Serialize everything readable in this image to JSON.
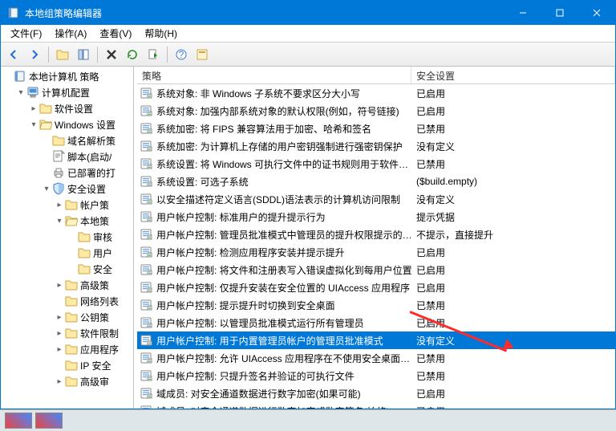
{
  "title": "本地组策略编辑器",
  "menu": [
    "文件(F)",
    "操作(A)",
    "查看(V)",
    "帮助(H)"
  ],
  "columns": {
    "policy": "策略",
    "setting": "安全设置"
  },
  "tree": {
    "root": {
      "label": "本地计算机 策略",
      "expandable": false
    },
    "computer_config": "计算机配置",
    "software_settings": "软件设置",
    "windows_settings": "Windows 设置",
    "dns": "域名解析策",
    "scripts": "脚本(启动/",
    "deployed": "已部署的打",
    "security": "安全设置",
    "account": "帐户策",
    "local": "本地策",
    "audit": "审核",
    "user_rights": "用户",
    "sec_options": "安全",
    "advanced": "高级策",
    "network": "网络列表",
    "public_key": "公钥策",
    "restrict": "软件限制",
    "app_ctrl": "应用程序",
    "ip_sec": "IP 安全",
    "adv_audit": "高级审"
  },
  "rows": [
    {
      "policy": "系统对象: 非 Windows 子系统不要求区分大小写",
      "setting": "已启用"
    },
    {
      "policy": "系统对象: 加强内部系统对象的默认权限(例如，符号链接)",
      "setting": "已启用"
    },
    {
      "policy": "系统加密: 将 FIPS 兼容算法用于加密、哈希和签名",
      "setting": "已禁用"
    },
    {
      "policy": "系统加密: 为计算机上存储的用户密钥强制进行强密钥保护",
      "setting": "没有定义"
    },
    {
      "policy": "系统设置: 将 Windows 可执行文件中的证书规则用于软件…",
      "setting": "已禁用"
    },
    {
      "policy": "系统设置: 可选子系统",
      "setting": "($build.empty)"
    },
    {
      "policy": "以安全描述符定义语言(SDDL)语法表示的计算机访问限制",
      "setting": "没有定义"
    },
    {
      "policy": "用户帐户控制: 标准用户的提升提示行为",
      "setting": "提示凭据"
    },
    {
      "policy": "用户帐户控制: 管理员批准模式中管理员的提升权限提示的…",
      "setting": "不提示，直接提升"
    },
    {
      "policy": "用户帐户控制: 检测应用程序安装并提示提升",
      "setting": "已启用"
    },
    {
      "policy": "用户帐户控制: 将文件和注册表写入错误虚拟化到每用户位置",
      "setting": "已启用"
    },
    {
      "policy": "用户帐户控制: 仅提升安装在安全位置的 UIAccess 应用程序",
      "setting": "已启用"
    },
    {
      "policy": "用户帐户控制: 提示提升时切换到安全桌面",
      "setting": "已禁用"
    },
    {
      "policy": "用户帐户控制: 以管理员批准模式运行所有管理员",
      "setting": "已启用"
    },
    {
      "policy": "用户帐户控制: 用于内置管理员帐户的管理员批准模式",
      "setting": "没有定义",
      "selected": true
    },
    {
      "policy": "用户帐户控制: 允许 UIAccess 应用程序在不使用安全桌面…",
      "setting": "已禁用"
    },
    {
      "policy": "用户帐户控制: 只提升签名并验证的可执行文件",
      "setting": "已禁用"
    },
    {
      "policy": "域成员: 对安全通道数据进行数字加密(如果可能)",
      "setting": "已启用"
    },
    {
      "policy": "域成员: 对安全通道数据进行数字加密或数字签名(始终)",
      "setting": "已启用"
    }
  ]
}
